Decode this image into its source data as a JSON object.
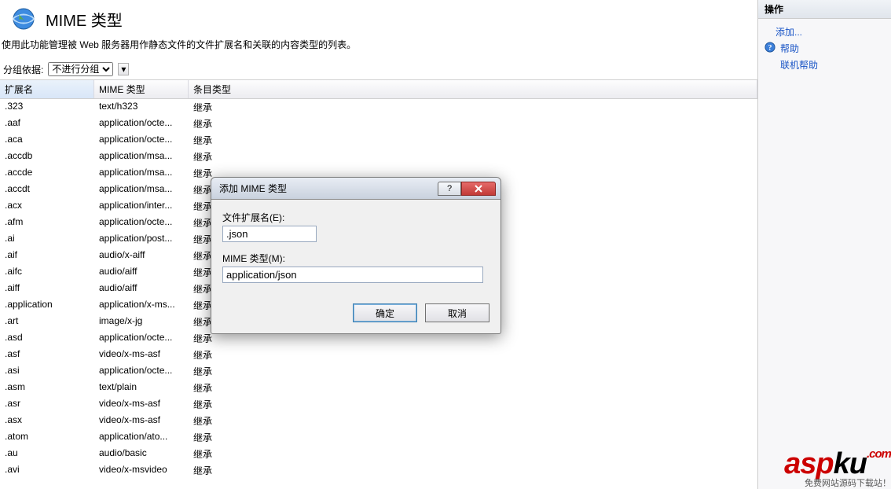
{
  "header": {
    "title": "MIME 类型",
    "description": "使用此功能管理被 Web 服务器用作静态文件的文件扩展名和关联的内容类型的列表。"
  },
  "grouping": {
    "label": "分组依据:",
    "selected": "不进行分组"
  },
  "columns": {
    "ext": "扩展名",
    "mime": "MIME 类型",
    "entry": "条目类型"
  },
  "inherit": "继承",
  "rows": [
    {
      "ext": ".323",
      "mime": "text/h323"
    },
    {
      "ext": ".aaf",
      "mime": "application/octe..."
    },
    {
      "ext": ".aca",
      "mime": "application/octe..."
    },
    {
      "ext": ".accdb",
      "mime": "application/msa..."
    },
    {
      "ext": ".accde",
      "mime": "application/msa..."
    },
    {
      "ext": ".accdt",
      "mime": "application/msa..."
    },
    {
      "ext": ".acx",
      "mime": "application/inter..."
    },
    {
      "ext": ".afm",
      "mime": "application/octe..."
    },
    {
      "ext": ".ai",
      "mime": "application/post..."
    },
    {
      "ext": ".aif",
      "mime": "audio/x-aiff"
    },
    {
      "ext": ".aifc",
      "mime": "audio/aiff"
    },
    {
      "ext": ".aiff",
      "mime": "audio/aiff"
    },
    {
      "ext": ".application",
      "mime": "application/x-ms..."
    },
    {
      "ext": ".art",
      "mime": "image/x-jg"
    },
    {
      "ext": ".asd",
      "mime": "application/octe..."
    },
    {
      "ext": ".asf",
      "mime": "video/x-ms-asf"
    },
    {
      "ext": ".asi",
      "mime": "application/octe..."
    },
    {
      "ext": ".asm",
      "mime": "text/plain"
    },
    {
      "ext": ".asr",
      "mime": "video/x-ms-asf"
    },
    {
      "ext": ".asx",
      "mime": "video/x-ms-asf"
    },
    {
      "ext": ".atom",
      "mime": "application/ato..."
    },
    {
      "ext": ".au",
      "mime": "audio/basic"
    },
    {
      "ext": ".avi",
      "mime": "video/x-msvideo"
    }
  ],
  "dialog": {
    "title": "添加 MIME 类型",
    "extLabel": "文件扩展名(E):",
    "extValue": ".json",
    "mimeLabel": "MIME 类型(M):",
    "mimeValue": "application/json",
    "ok": "确定",
    "cancel": "取消"
  },
  "actions": {
    "heading": "操作",
    "add": "添加...",
    "help": "帮助",
    "online": "联机帮助"
  },
  "watermark": {
    "part1": "asp",
    "part2": "ku",
    "dotcom": ".com",
    "sub": "免费网站源码下载站！"
  }
}
